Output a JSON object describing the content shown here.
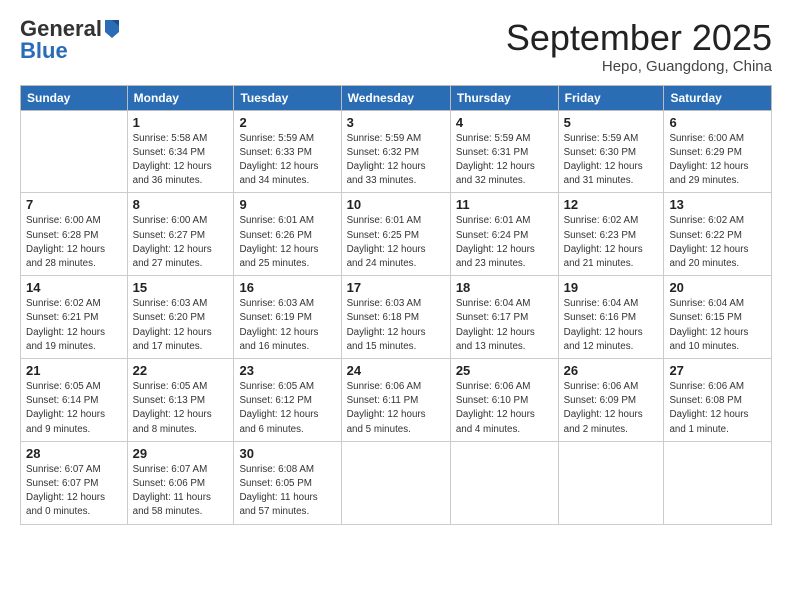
{
  "header": {
    "logo_general": "General",
    "logo_blue": "Blue",
    "month": "September 2025",
    "location": "Hepo, Guangdong, China"
  },
  "weekdays": [
    "Sunday",
    "Monday",
    "Tuesday",
    "Wednesday",
    "Thursday",
    "Friday",
    "Saturday"
  ],
  "weeks": [
    [
      {
        "num": "",
        "info": ""
      },
      {
        "num": "1",
        "info": "Sunrise: 5:58 AM\nSunset: 6:34 PM\nDaylight: 12 hours\nand 36 minutes."
      },
      {
        "num": "2",
        "info": "Sunrise: 5:59 AM\nSunset: 6:33 PM\nDaylight: 12 hours\nand 34 minutes."
      },
      {
        "num": "3",
        "info": "Sunrise: 5:59 AM\nSunset: 6:32 PM\nDaylight: 12 hours\nand 33 minutes."
      },
      {
        "num": "4",
        "info": "Sunrise: 5:59 AM\nSunset: 6:31 PM\nDaylight: 12 hours\nand 32 minutes."
      },
      {
        "num": "5",
        "info": "Sunrise: 5:59 AM\nSunset: 6:30 PM\nDaylight: 12 hours\nand 31 minutes."
      },
      {
        "num": "6",
        "info": "Sunrise: 6:00 AM\nSunset: 6:29 PM\nDaylight: 12 hours\nand 29 minutes."
      }
    ],
    [
      {
        "num": "7",
        "info": "Sunrise: 6:00 AM\nSunset: 6:28 PM\nDaylight: 12 hours\nand 28 minutes."
      },
      {
        "num": "8",
        "info": "Sunrise: 6:00 AM\nSunset: 6:27 PM\nDaylight: 12 hours\nand 27 minutes."
      },
      {
        "num": "9",
        "info": "Sunrise: 6:01 AM\nSunset: 6:26 PM\nDaylight: 12 hours\nand 25 minutes."
      },
      {
        "num": "10",
        "info": "Sunrise: 6:01 AM\nSunset: 6:25 PM\nDaylight: 12 hours\nand 24 minutes."
      },
      {
        "num": "11",
        "info": "Sunrise: 6:01 AM\nSunset: 6:24 PM\nDaylight: 12 hours\nand 23 minutes."
      },
      {
        "num": "12",
        "info": "Sunrise: 6:02 AM\nSunset: 6:23 PM\nDaylight: 12 hours\nand 21 minutes."
      },
      {
        "num": "13",
        "info": "Sunrise: 6:02 AM\nSunset: 6:22 PM\nDaylight: 12 hours\nand 20 minutes."
      }
    ],
    [
      {
        "num": "14",
        "info": "Sunrise: 6:02 AM\nSunset: 6:21 PM\nDaylight: 12 hours\nand 19 minutes."
      },
      {
        "num": "15",
        "info": "Sunrise: 6:03 AM\nSunset: 6:20 PM\nDaylight: 12 hours\nand 17 minutes."
      },
      {
        "num": "16",
        "info": "Sunrise: 6:03 AM\nSunset: 6:19 PM\nDaylight: 12 hours\nand 16 minutes."
      },
      {
        "num": "17",
        "info": "Sunrise: 6:03 AM\nSunset: 6:18 PM\nDaylight: 12 hours\nand 15 minutes."
      },
      {
        "num": "18",
        "info": "Sunrise: 6:04 AM\nSunset: 6:17 PM\nDaylight: 12 hours\nand 13 minutes."
      },
      {
        "num": "19",
        "info": "Sunrise: 6:04 AM\nSunset: 6:16 PM\nDaylight: 12 hours\nand 12 minutes."
      },
      {
        "num": "20",
        "info": "Sunrise: 6:04 AM\nSunset: 6:15 PM\nDaylight: 12 hours\nand 10 minutes."
      }
    ],
    [
      {
        "num": "21",
        "info": "Sunrise: 6:05 AM\nSunset: 6:14 PM\nDaylight: 12 hours\nand 9 minutes."
      },
      {
        "num": "22",
        "info": "Sunrise: 6:05 AM\nSunset: 6:13 PM\nDaylight: 12 hours\nand 8 minutes."
      },
      {
        "num": "23",
        "info": "Sunrise: 6:05 AM\nSunset: 6:12 PM\nDaylight: 12 hours\nand 6 minutes."
      },
      {
        "num": "24",
        "info": "Sunrise: 6:06 AM\nSunset: 6:11 PM\nDaylight: 12 hours\nand 5 minutes."
      },
      {
        "num": "25",
        "info": "Sunrise: 6:06 AM\nSunset: 6:10 PM\nDaylight: 12 hours\nand 4 minutes."
      },
      {
        "num": "26",
        "info": "Sunrise: 6:06 AM\nSunset: 6:09 PM\nDaylight: 12 hours\nand 2 minutes."
      },
      {
        "num": "27",
        "info": "Sunrise: 6:06 AM\nSunset: 6:08 PM\nDaylight: 12 hours\nand 1 minute."
      }
    ],
    [
      {
        "num": "28",
        "info": "Sunrise: 6:07 AM\nSunset: 6:07 PM\nDaylight: 12 hours\nand 0 minutes."
      },
      {
        "num": "29",
        "info": "Sunrise: 6:07 AM\nSunset: 6:06 PM\nDaylight: 11 hours\nand 58 minutes."
      },
      {
        "num": "30",
        "info": "Sunrise: 6:08 AM\nSunset: 6:05 PM\nDaylight: 11 hours\nand 57 minutes."
      },
      {
        "num": "",
        "info": ""
      },
      {
        "num": "",
        "info": ""
      },
      {
        "num": "",
        "info": ""
      },
      {
        "num": "",
        "info": ""
      }
    ]
  ]
}
